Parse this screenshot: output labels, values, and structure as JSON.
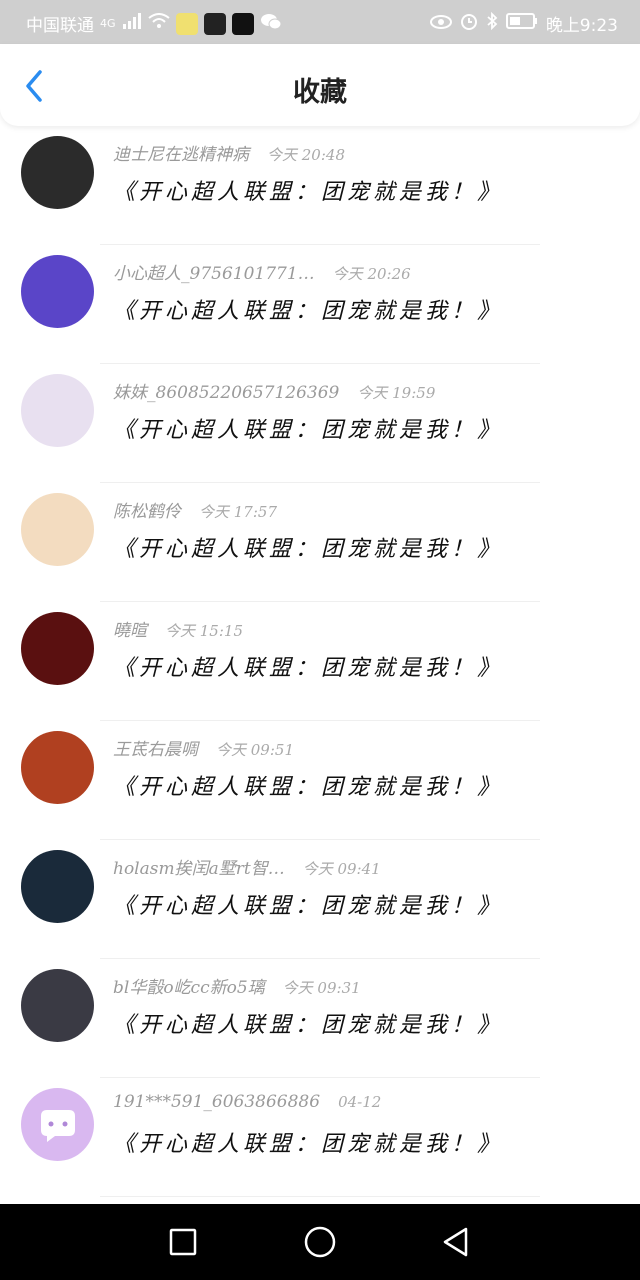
{
  "statusbar": {
    "carrier": "中国联通",
    "network": "4G",
    "time": "晚上9:23"
  },
  "header": {
    "title": "收藏"
  },
  "colors": {
    "accent": "#2a8cf0",
    "meta": "#9a9a9a"
  },
  "favorites": [
    {
      "user": "迪士尼在逃精神病",
      "time": "今天 20:48",
      "content": "《开心超人联盟：团宠就是我！》",
      "avatar_color": "#2b2b2b"
    },
    {
      "user": "小心超人_9756101771…",
      "time": "今天 20:26",
      "content": "《开心超人联盟：团宠就是我！》",
      "avatar_color": "#5a45c8"
    },
    {
      "user": "妹妹_86085220657126369",
      "time": "今天 19:59",
      "content": "《开心超人联盟：团宠就是我！》",
      "avatar_color": "#e8e0f0"
    },
    {
      "user": "陈松鹤伶",
      "time": "今天 17:57",
      "content": "《开心超人联盟：团宠就是我！》",
      "avatar_color": "#f3dcc0"
    },
    {
      "user": "曉暄",
      "time": "今天 15:15",
      "content": "《开心超人联盟：团宠就是我！》",
      "avatar_color": "#5a1010"
    },
    {
      "user": "王茋右晨啁",
      "time": "今天 09:51",
      "content": "《开心超人联盟：团宠就是我！》",
      "avatar_color": "#b04020"
    },
    {
      "user": "holasm挨闰a墅rt智…",
      "time": "今天 09:41",
      "content": "《开心超人联盟：团宠就是我！》",
      "avatar_color": "#1a2a3a"
    },
    {
      "user": "bl华瞉o屹cc新o5璃",
      "time": "今天 09:31",
      "content": "《开心超人联盟：团宠就是我！》",
      "avatar_color": "#3a3a44"
    },
    {
      "user": "191***591_6063866886",
      "time": "04-12",
      "content": "《开心超人联盟：团宠就是我！》",
      "avatar_color": "#d9b8f0"
    }
  ],
  "icons": {
    "back": "chevron-left-icon",
    "nav_recent": "square-icon",
    "nav_home": "circle-icon",
    "nav_back": "triangle-left-icon"
  }
}
